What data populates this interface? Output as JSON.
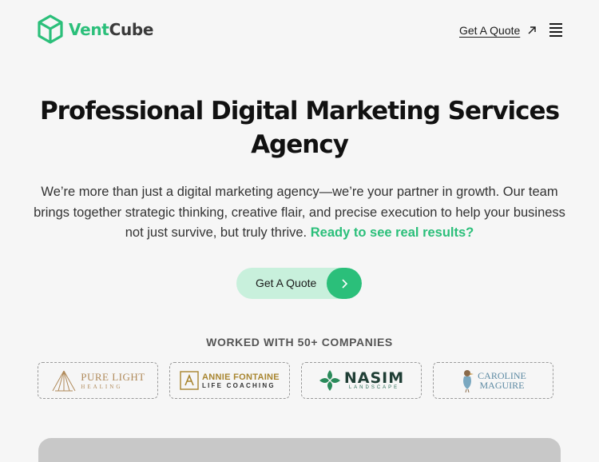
{
  "header": {
    "logo_vent": "Vent",
    "logo_cube": "Cube",
    "quote_label": "Get A Quote",
    "arrow_icon": "arrow-up-right-icon",
    "menu_icon": "hamburger-menu-icon"
  },
  "hero": {
    "title": "Professional Digital Marketing Services Agency",
    "description": "We’re more than just a digital marketing agency—we’re your partner in growth. Our team brings together strategic thinking, creative flair, and precise execution to help your business not just survive, but truly thrive.",
    "highlight": "Ready to see real results?",
    "cta_label": "Get A Quote"
  },
  "clients": {
    "heading": "WORKED WITH 50+ COMPANIES",
    "logos": [
      {
        "name": "PURE LIGHT",
        "sub": "HEALING"
      },
      {
        "name": "ANNIE FONTAINE",
        "sub": "LIFE COACHING"
      },
      {
        "name": "NASIM",
        "sub": "LANDSCAPE"
      },
      {
        "name": "CAROLINE",
        "sub": "MAGUIRE"
      }
    ]
  },
  "colors": {
    "accent": "#2bbf7a",
    "accent_light": "#c8f0dc",
    "text": "#1a1a1a",
    "background": "#f6f6f6"
  }
}
